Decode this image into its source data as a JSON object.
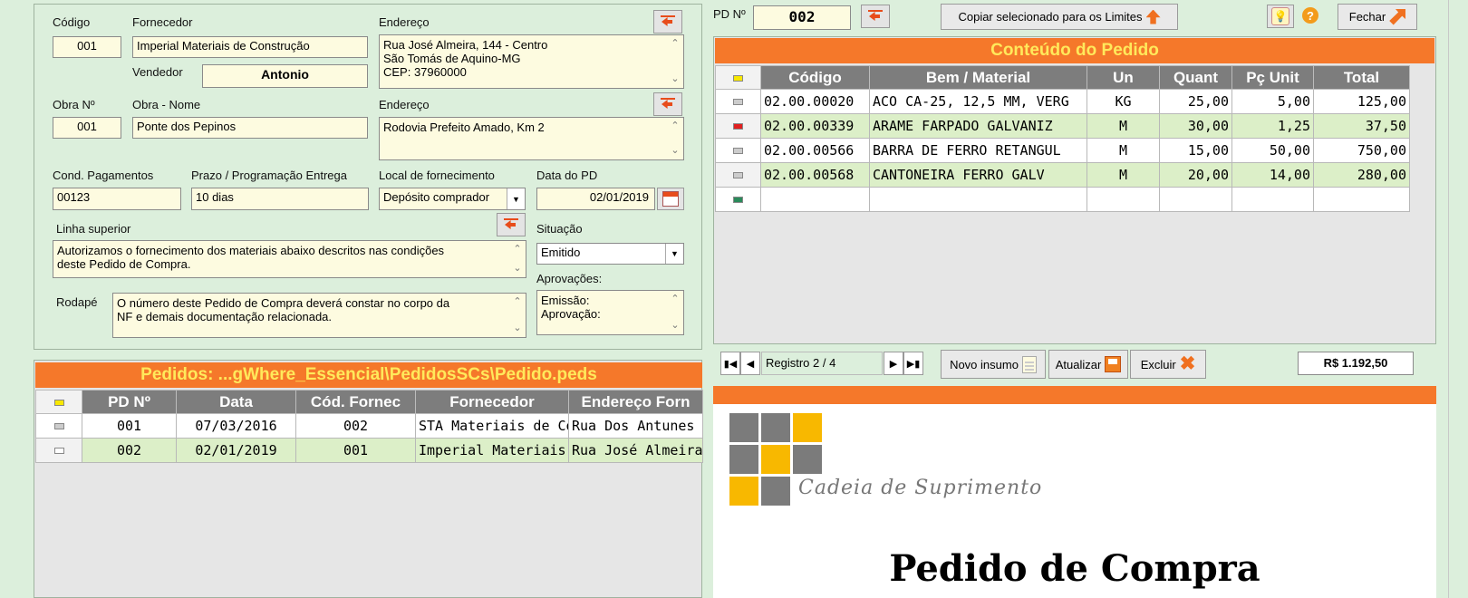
{
  "order_header": {
    "codigo_label": "Código",
    "codigo": "001",
    "fornecedor_label": "Fornecedor",
    "fornecedor": "Imperial Materiais de Construção",
    "endereco_label": "Endereço",
    "endereco": "Rua José Almeira, 144 - Centro\nSão Tomás de Aquino-MG\nCEP: 37960000",
    "vendedor_label": "Vendedor",
    "vendedor": "Antonio",
    "obra_num_label": "Obra Nº",
    "obra_num": "001",
    "obra_nome_label": "Obra - Nome",
    "obra_nome": "Ponte dos Pepinos",
    "obra_endereco_label": "Endereço",
    "obra_endereco": "Rodovia Prefeito Amado, Km 2",
    "cond_pag_label": "Cond. Pagamentos",
    "cond_pag": "00123",
    "prazo_label": "Prazo / Programação Entrega",
    "prazo": "10 dias",
    "local_label": "Local de fornecimento",
    "local": "Depósito comprador",
    "data_label": "Data do PD",
    "data": "02/01/2019",
    "linha_label": "Linha superior",
    "linha": "Autorizamos o fornecimento dos materiais abaixo descritos nas condições\ndeste Pedido de Compra.",
    "situacao_label": "Situação",
    "situacao": "Emitido",
    "aprov_label": "Aprovações:",
    "aprov": "Emissão:\nAprovação:",
    "rodape_label": "Rodapé",
    "rodape": "O número deste Pedido de Compra deverá constar no corpo da\nNF e demais documentação relacionada."
  },
  "orders_list": {
    "title": "Pedidos: ...gWhere_Essencial\\PedidosSCs\\Pedido.peds",
    "columns": [
      "PD Nº",
      "Data",
      "Cód. Fornec",
      "Fornecedor",
      "Endereço Forn"
    ],
    "rows": [
      [
        "001",
        "07/03/2016",
        "002",
        "STA Materiais de Constr",
        "Rua Dos Antunes"
      ],
      [
        "002",
        "02/01/2019",
        "001",
        "Imperial Materiais",
        "Rua José Almeira"
      ]
    ]
  },
  "toolbar": {
    "pd_label": "PD Nº",
    "pd_value": "002",
    "copy_label": "Copiar selecionado para os Limites",
    "help_icon": "?",
    "close_label": "Fechar"
  },
  "content": {
    "title": "Conteúdo do Pedido",
    "columns": [
      "Código",
      "Bem / Material",
      "Un",
      "Quant",
      "Pç Unit",
      "Total"
    ],
    "rows": [
      [
        "02.00.00020",
        "ACO CA-25, 12,5 MM, VERG",
        "KG",
        "25,00",
        "5,00",
        "125,00"
      ],
      [
        "02.00.00339",
        "ARAME FARPADO GALVANIZ",
        "M",
        "30,00",
        "1,25",
        "37,50"
      ],
      [
        "02.00.00566",
        "BARRA DE FERRO RETANGUL",
        "M",
        "15,00",
        "50,00",
        "750,00"
      ],
      [
        "02.00.00568",
        "CANTONEIRA FERRO GALV",
        "M",
        "20,00",
        "14,00",
        "280,00"
      ]
    ]
  },
  "navigator": {
    "registro": "Registro 2 / 4",
    "novo": "Novo insumo",
    "atualizar": "Atualizar",
    "excluir": "Excluir",
    "total": "R$ 1.192,50"
  },
  "preview": {
    "company": "Cadeia de Suprimento",
    "doc_title": "Pedido de Compra"
  },
  "colors": {
    "accent": "#f5782a",
    "accent_text": "#ffe95b",
    "window_bg": "#dcefdc"
  }
}
